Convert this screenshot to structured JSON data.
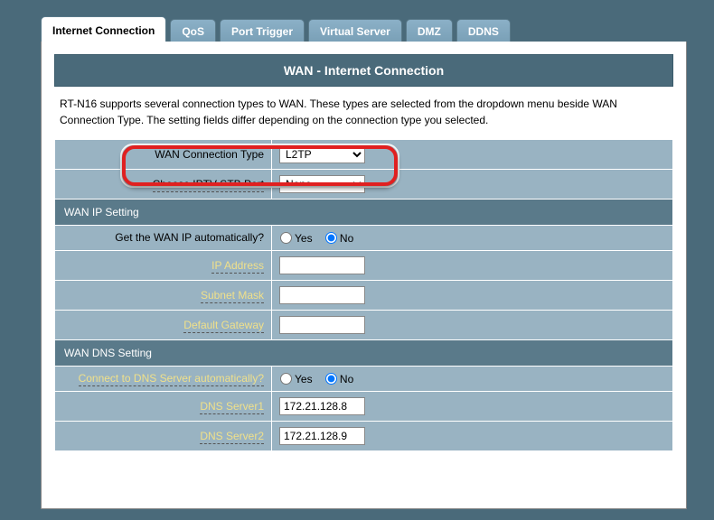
{
  "tabs": {
    "internet_connection": "Internet Connection",
    "qos": "QoS",
    "port_trigger": "Port Trigger",
    "virtual_server": "Virtual Server",
    "dmz": "DMZ",
    "ddns": "DDNS"
  },
  "header": "WAN - Internet Connection",
  "description": "RT-N16 supports several connection types to WAN. These types are selected from the dropdown menu beside WAN Connection Type. The setting fields differ depending on the connection type you selected.",
  "fields": {
    "wan_conn_type_label": "WAN Connection Type",
    "wan_conn_type_value": "L2TP",
    "iptv_port_label": "Choose IPTV STB Port",
    "iptv_port_value": "None"
  },
  "wan_ip_section": "WAN IP Setting",
  "wan_ip": {
    "auto_label": "Get the WAN IP automatically?",
    "yes": "Yes",
    "no": "No",
    "ip_label": "IP Address",
    "ip_value": "",
    "mask_label": "Subnet Mask",
    "mask_value": "",
    "gw_label": "Default Gateway",
    "gw_value": ""
  },
  "wan_dns_section": "WAN DNS Setting",
  "wan_dns": {
    "auto_label": "Connect to DNS Server automatically?",
    "yes": "Yes",
    "no": "No",
    "s1_label": "DNS Server1",
    "s1_value": "172.21.128.8",
    "s2_label": "DNS Server2",
    "s2_value": "172.21.128.9"
  }
}
